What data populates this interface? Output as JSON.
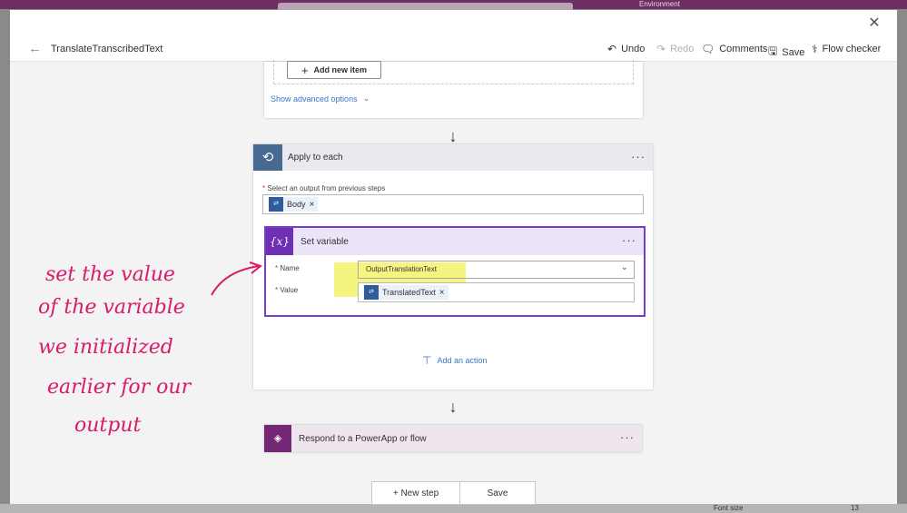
{
  "background": {
    "environment_label": "Environment",
    "font_size_label": "Font size",
    "font_size_value": "13"
  },
  "dialog": {
    "close_icon": "close-icon",
    "command_bar": {
      "flow_name": "TranslateTranscribedText",
      "undo": "Undo",
      "redo": "Redo",
      "comments": "Comments",
      "save": "Save",
      "flow_checker": "Flow checker"
    }
  },
  "canvas": {
    "previous_card": {
      "add_item": "Add new item",
      "advanced": "Show advanced options"
    },
    "apply_to_each": {
      "title": "Apply to each",
      "select_label": "Select an output from previous steps",
      "token": "Body",
      "set_variable": {
        "title": "Set variable",
        "name_label": "Name",
        "name_value": "OutputTranslationText",
        "value_label": "Value",
        "value_token": "TranslatedText"
      },
      "add_action": "Add an action"
    },
    "respond": {
      "title": "Respond to a PowerApp or flow"
    },
    "new_step": "+ New step",
    "save": "Save"
  },
  "annotation": {
    "lines": [
      "set the value",
      "of the variable",
      "we initialized",
      "earlier for our",
      "output"
    ]
  },
  "colors": {
    "accent_purple": "#7a3bd0",
    "apply_blue": "#486991",
    "respond_purple": "#742774",
    "highlight": "#f6f37a",
    "ink_pink": "#d81b6b"
  }
}
